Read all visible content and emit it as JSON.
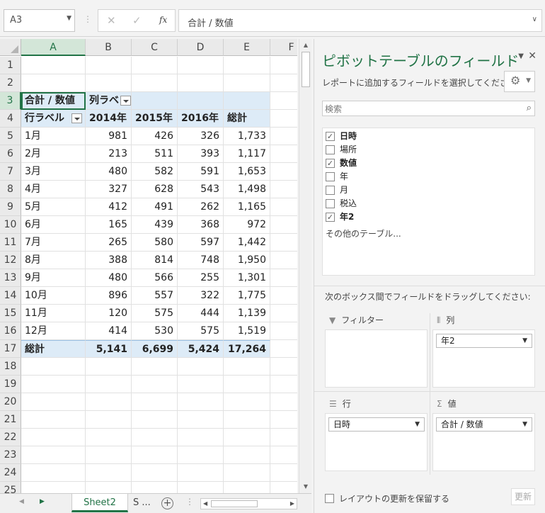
{
  "formula_bar": {
    "name_box": "A3",
    "cancel_icon": "✕",
    "enter_icon": "✓",
    "fx_label": "fx",
    "formula": "合計 / 数値"
  },
  "grid": {
    "columns": [
      "A",
      "B",
      "C",
      "D",
      "E",
      "F"
    ],
    "row_numbers": [
      "1",
      "2",
      "3",
      "4",
      "5",
      "6",
      "7",
      "8",
      "9",
      "10",
      "11",
      "12",
      "13",
      "14",
      "15",
      "16",
      "17",
      "18",
      "19",
      "20",
      "21",
      "22",
      "23",
      "24",
      "25"
    ],
    "pivot": {
      "value_label": "合計 / 数値",
      "column_label_header": "列ラベ",
      "row_label_header": "行ラベル",
      "column_headers": [
        "2014年",
        "2015年",
        "2016年",
        "総計"
      ],
      "rows": [
        {
          "label": "1月",
          "values": [
            "981",
            "426",
            "326",
            "1,733"
          ]
        },
        {
          "label": "2月",
          "values": [
            "213",
            "511",
            "393",
            "1,117"
          ]
        },
        {
          "label": "3月",
          "values": [
            "480",
            "582",
            "591",
            "1,653"
          ]
        },
        {
          "label": "4月",
          "values": [
            "327",
            "628",
            "543",
            "1,498"
          ]
        },
        {
          "label": "5月",
          "values": [
            "412",
            "491",
            "262",
            "1,165"
          ]
        },
        {
          "label": "6月",
          "values": [
            "165",
            "439",
            "368",
            "972"
          ]
        },
        {
          "label": "7月",
          "values": [
            "265",
            "580",
            "597",
            "1,442"
          ]
        },
        {
          "label": "8月",
          "values": [
            "388",
            "814",
            "748",
            "1,950"
          ]
        },
        {
          "label": "9月",
          "values": [
            "480",
            "566",
            "255",
            "1,301"
          ]
        },
        {
          "label": "10月",
          "values": [
            "896",
            "557",
            "322",
            "1,775"
          ]
        },
        {
          "label": "11月",
          "values": [
            "120",
            "575",
            "444",
            "1,139"
          ]
        },
        {
          "label": "12月",
          "values": [
            "414",
            "530",
            "575",
            "1,519"
          ]
        }
      ],
      "grand_total": {
        "label": "総計",
        "values": [
          "5,141",
          "6,699",
          "5,424",
          "17,264"
        ]
      }
    }
  },
  "sheet_tabs": {
    "active": "Sheet2",
    "other": "S ...",
    "add_icon": "+"
  },
  "pivot_pane": {
    "title": "ピボットテーブルのフィールド",
    "subtitle": "レポートに追加するフィールドを選択してください:",
    "search_placeholder": "検索",
    "fields": [
      {
        "name": "日時",
        "checked": true
      },
      {
        "name": "場所",
        "checked": false
      },
      {
        "name": "数値",
        "checked": true
      },
      {
        "name": "年",
        "checked": false
      },
      {
        "name": "月",
        "checked": false
      },
      {
        "name": "税込",
        "checked": false
      },
      {
        "name": "年2",
        "checked": true
      }
    ],
    "more_tables": "その他のテーブル...",
    "drag_hint": "次のボックス間でフィールドをドラッグしてください:",
    "areas": {
      "filter": {
        "label": "フィルター"
      },
      "columns": {
        "label": "列",
        "item": "年2"
      },
      "rows": {
        "label": "行",
        "item": "日時"
      },
      "values": {
        "label": "値",
        "item": "合計 / 数値"
      }
    },
    "defer_label": "レイアウトの更新を保留する",
    "update_label": "更新"
  }
}
